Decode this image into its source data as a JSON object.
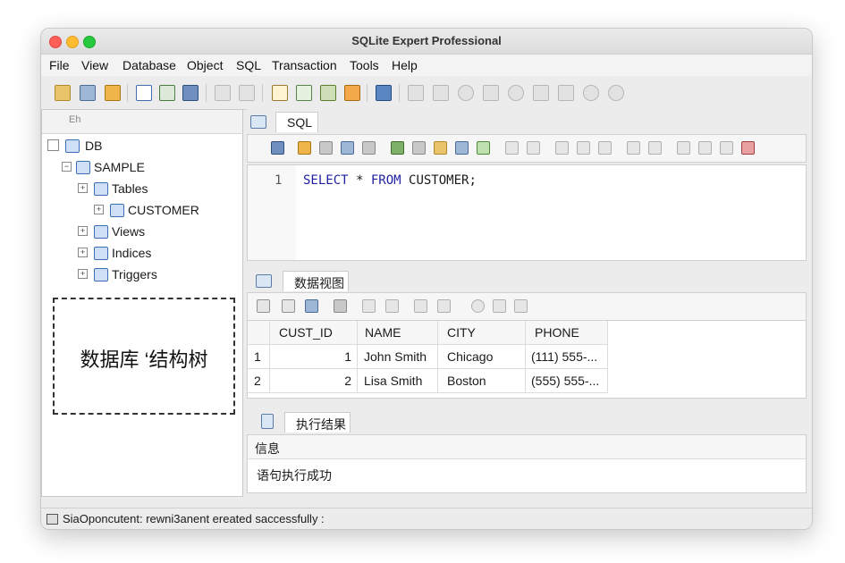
{
  "window": {
    "title": "SQLite Expert Professional"
  },
  "menu": [
    "File",
    "View",
    "Database",
    "Object",
    "SQL",
    "Transaction",
    "Tools",
    "Help"
  ],
  "left_panel": {
    "header": "Eh",
    "tree": {
      "db": "DB",
      "schema": "SAMPLE",
      "tables": "Tables",
      "customer": "CUSTOMER",
      "views": "Views",
      "indices": "Indices",
      "triggers": "Triggers"
    },
    "annotation": "数据库 ‘结构树"
  },
  "sql_tab": {
    "label": "SQL",
    "line_number": "1",
    "kw1": "SELECT",
    "mid": " * ",
    "kw2": "FROM",
    "rest": " CUSTOMER;"
  },
  "data_tab": {
    "label": "数据视图"
  },
  "grid": {
    "columns": [
      "CUST_ID",
      "NAME",
      "CITY",
      "PHONE"
    ],
    "rows": [
      {
        "row_no": "1",
        "cust_id": "1",
        "name": "John Smith",
        "city": "Chicago",
        "phone": "(111) 555-..."
      },
      {
        "row_no": "2",
        "cust_id": "2",
        "name": "Lisa Smith",
        "city": "Boston",
        "phone": "(555) 555-..."
      }
    ]
  },
  "result_tab": {
    "label": "执行结果",
    "header": "信息",
    "message": "语句执行成功"
  },
  "status": {
    "text": "SiaOponcutent: rewni3anent ereated saccessfully :"
  }
}
